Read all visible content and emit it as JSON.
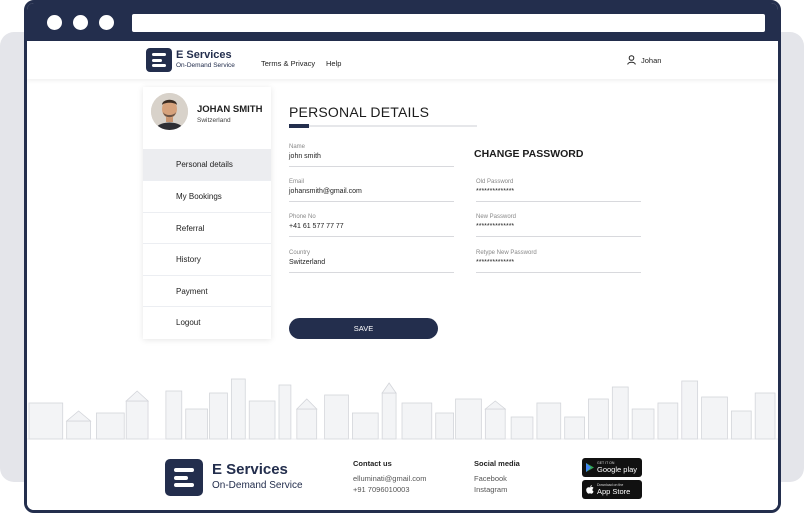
{
  "header": {
    "brand_title": "E Services",
    "brand_subtitle": "On-Demand Service",
    "nav": [
      "Terms & Privacy",
      "Help"
    ],
    "user_name": "Johan"
  },
  "profile": {
    "name": "JOHAN SMITH",
    "location": "Switzerland"
  },
  "sidebar": {
    "items": [
      {
        "label": "Personal details",
        "active": true
      },
      {
        "label": "My Bookings"
      },
      {
        "label": "Referral"
      },
      {
        "label": "History"
      },
      {
        "label": "Payment"
      },
      {
        "label": "Logout"
      }
    ]
  },
  "personal": {
    "title": "PERSONAL DETAILS",
    "fields": [
      {
        "label": "Name",
        "value": "john smith"
      },
      {
        "label": "Email",
        "value": "johansmith@gmail.com"
      },
      {
        "label": "Phone No",
        "value": "+41 61 577 77 77"
      },
      {
        "label": "Country",
        "value": "Switzerland"
      }
    ]
  },
  "password": {
    "title": "CHANGE PASSWORD",
    "fields": [
      {
        "label": "Old Password",
        "value": "**************"
      },
      {
        "label": "New Password",
        "value": "**************"
      },
      {
        "label": "Retype New Password",
        "value": "**************"
      }
    ]
  },
  "save_label": "SAVE",
  "footer": {
    "brand_title": "E Services",
    "brand_subtitle": "On-Demand Service",
    "contact_head": "Contact us",
    "email": "elluminati@gmail.com",
    "phone": "+91 7096010003",
    "social_head": "Social media",
    "social": [
      "Facebook",
      "Instagram"
    ],
    "google_small": "GET IT ON",
    "google_big": "Google play",
    "apple_small": "Download on the",
    "apple_big": "App Store"
  },
  "colors": {
    "primary": "#232e4d",
    "background": "#e4e5ea"
  },
  "icons": {
    "user": "user-icon",
    "logo": "e-logo-icon",
    "google": "play-icon",
    "apple": "apple-icon"
  }
}
